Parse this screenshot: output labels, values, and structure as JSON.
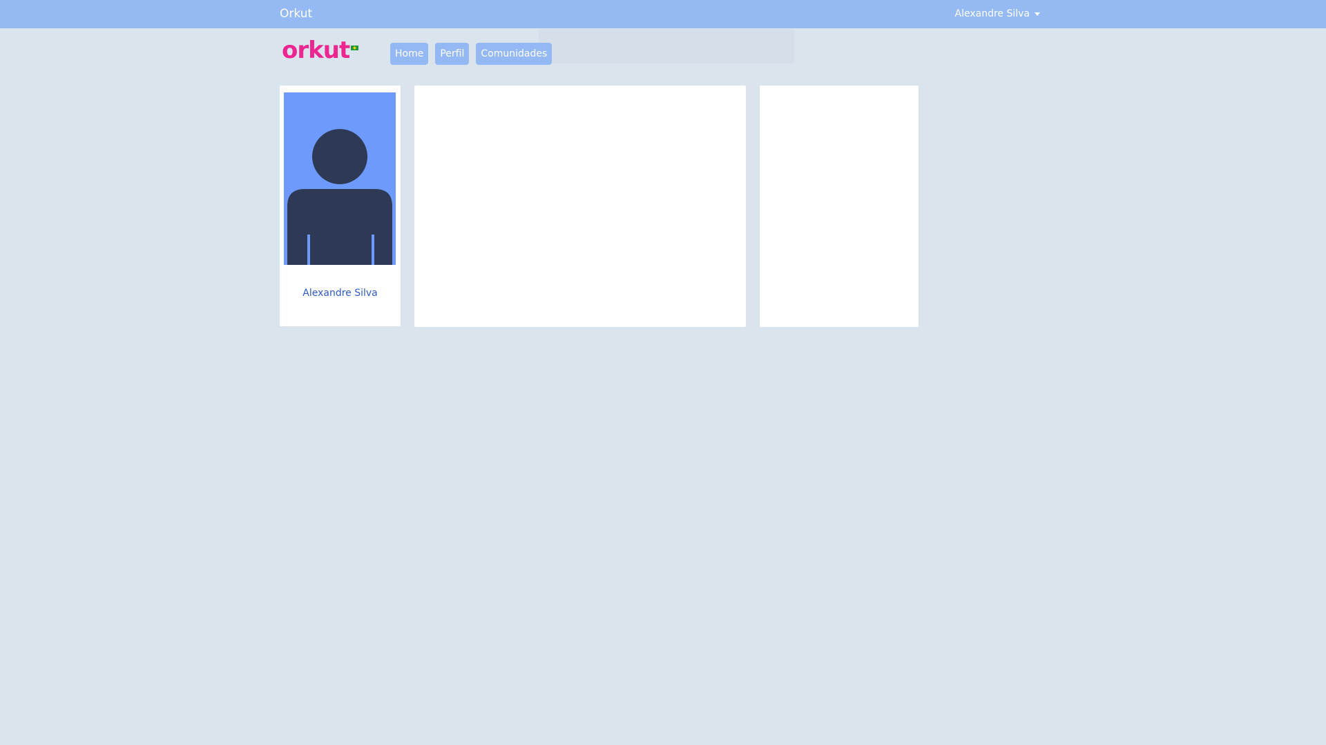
{
  "topbar": {
    "brand": "Orkut",
    "user_name": "Alexandre Silva"
  },
  "logo": {
    "text": "orkut"
  },
  "nav": {
    "items": [
      {
        "label": "Home"
      },
      {
        "label": "Perfil"
      },
      {
        "label": "Comunidades"
      }
    ]
  },
  "profile": {
    "name": "Alexandre Silva",
    "avatar_icon": "person-silhouette-icon"
  },
  "colors": {
    "topbar": "#95b9f3",
    "background": "#dae4ed",
    "logo": "#ed2590",
    "nav_button": "#94b8f3",
    "avatar_bg": "#6f9afd",
    "avatar_figure": "#2e3a55",
    "profile_link": "#2e5bbd"
  }
}
